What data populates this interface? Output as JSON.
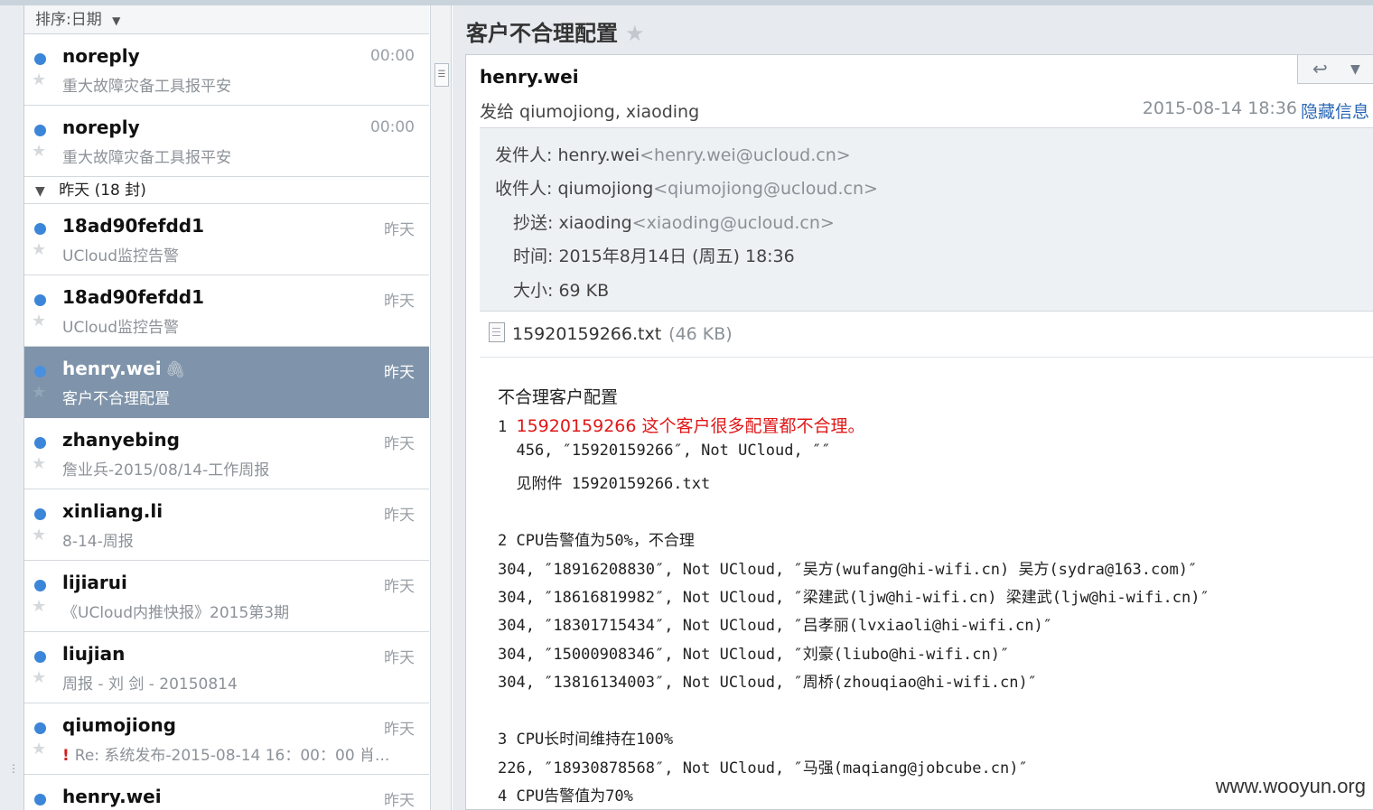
{
  "sort_label": "排序:日期",
  "list": {
    "top_mails": [
      {
        "sender": "noreply",
        "date": "00:00",
        "subject": "重大故障灾备工具报平安"
      },
      {
        "sender": "noreply",
        "date": "00:00",
        "subject": "重大故障灾备工具报平安"
      }
    ],
    "group_label": "昨天 (18 封)",
    "mails": [
      {
        "sender": "18ad90fefdd1",
        "date": "昨天",
        "subject": "UCloud监控告警"
      },
      {
        "sender": "18ad90fefdd1",
        "date": "昨天",
        "subject": "UCloud监控告警"
      },
      {
        "sender": "henry.wei",
        "date": "昨天",
        "subject": "客户不合理配置"
      },
      {
        "sender": "zhanyebing",
        "date": "昨天",
        "subject": "詹业兵-2015/08/14-工作周报"
      },
      {
        "sender": "xinliang.li",
        "date": "昨天",
        "subject": "8-14-周报"
      },
      {
        "sender": "lijiarui",
        "date": "昨天",
        "subject": "《UCloud内推快报》2015第3期"
      },
      {
        "sender": "liujian",
        "date": "昨天",
        "subject": "周报 - 刘 剑 - 20150814"
      },
      {
        "sender": "qiumojiong",
        "date": "昨天",
        "subject": "Re: 系统发布-2015-08-14 16：00：00 肖..."
      },
      {
        "sender": "henry.wei",
        "date": "昨天",
        "subject": ""
      }
    ]
  },
  "reader": {
    "subject": "客户不合理配置",
    "from": "henry.wei",
    "to_line": "发给 qiumojiong, xiaoding",
    "sent": "2015-08-14 18:36",
    "hide_label": "隐藏信息",
    "details": {
      "from_label": "发件人:",
      "from_name": "henry.wei",
      "from_addr": "<henry.wei@ucloud.cn>",
      "to_label": "收件人:",
      "to_name": "qiumojiong",
      "to_addr": "<qiumojiong@ucloud.cn>",
      "cc_label": "抄送:",
      "cc_name": "xiaoding",
      "cc_addr": "<xiaoding@ucloud.cn>",
      "time_label": "时间:",
      "time_value": "2015年8月14日 (周五) 18:36",
      "size_label": "大小:",
      "size_value": "69 KB"
    },
    "attachment": {
      "name": "15920159266.txt",
      "size": "(46 KB)"
    },
    "body": {
      "title": "不合理客户配置",
      "l1_num": "1 ",
      "l1_red": "15920159266 这个客户很多配置都不合理。",
      "l2": "  456, ″15920159266″, Not UCloud, ″″",
      "l3": "  见附件 15920159266.txt",
      "l4": "2 CPU告警值为50%，不合理",
      "l5": "304, ″18916208830″, Not UCloud, ″吴方(wufang@hi-wifi.cn) 吴方(sydra@163.com)″",
      "l6": "304, ″18616819982″, Not UCloud, ″梁建武(ljw@hi-wifi.cn) 梁建武(ljw@hi-wifi.cn)″",
      "l7": "304, ″18301715434″, Not UCloud, ″吕孝丽(lvxiaoli@hi-wifi.cn)″",
      "l8": "304, ″15000908346″, Not UCloud, ″刘豪(liubo@hi-wifi.cn)″",
      "l9": "304, ″13816134003″, Not UCloud, ″周桥(zhouqiao@hi-wifi.cn)″",
      "l10": "3 CPU长时间维持在100%",
      "l11": "226, ″18930878568″, Not UCloud, ″马强(maqiang@jobcube.cn)″",
      "l12": "4 CPU告警值为70%"
    }
  },
  "watermark": "www.wooyun.org"
}
